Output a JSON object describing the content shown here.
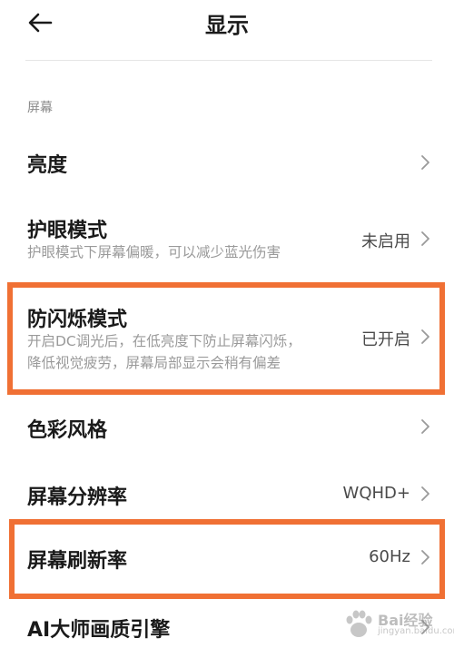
{
  "header": {
    "title": "显示",
    "back_icon": "back-arrow-icon"
  },
  "section": {
    "label": "屏幕"
  },
  "rows": {
    "brightness": {
      "title": "亮度",
      "value": ""
    },
    "eye_care": {
      "title": "护眼模式",
      "subtitle": "护眼模式下屏幕偏暖，可以减少蓝光伤害",
      "value": "未启用"
    },
    "anti_flicker": {
      "title": "防闪烁模式",
      "subtitle_line1": "开启DC调光后，在低亮度下防止屏幕闪烁，",
      "subtitle_line2": "降低视觉疲劳，屏幕局部显示会稍有偏差",
      "value": "已开启"
    },
    "color_style": {
      "title": "色彩风格",
      "value": ""
    },
    "resolution": {
      "title": "屏幕分辨率",
      "value": "WQHD+"
    },
    "refresh_rate": {
      "title": "屏幕刷新率",
      "value": "60Hz"
    },
    "ai_engine": {
      "title": "AI大师画质引擎",
      "value": ""
    }
  },
  "highlight_color": "#f07034",
  "watermark": {
    "text": "Bai经验",
    "url": "jingyan.baidu.com"
  }
}
